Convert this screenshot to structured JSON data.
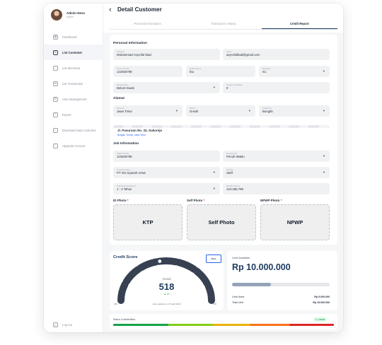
{
  "sidebar": {
    "profile": {
      "name": "Admin Nexs",
      "role": "Admin"
    },
    "items": [
      {
        "label": "Dashboard",
        "icon": "dashboard-icon",
        "glyph": "▦",
        "active": false
      },
      {
        "label": "List Customer",
        "icon": "users-icon",
        "glyph": "☺",
        "active": true
      },
      {
        "label": "List Merchant",
        "icon": "store-icon",
        "glyph": "⌂",
        "active": false
      },
      {
        "label": "List Transaction",
        "icon": "transaction-icon",
        "glyph": "⇄",
        "active": false
      },
      {
        "label": "User Management",
        "icon": "user-gear-icon",
        "glyph": "⚙",
        "active": false
      },
      {
        "label": "Report",
        "icon": "report-icon",
        "glyph": "≡",
        "active": false
      },
      {
        "label": "Download Data Customer",
        "icon": "download-icon",
        "glyph": "↓",
        "active": false
      },
      {
        "label": "Upgrade Account",
        "icon": "upgrade-icon",
        "glyph": "↑",
        "active": false
      }
    ],
    "logout_label": "Log out"
  },
  "header": {
    "title": "Detail Customer",
    "tabs": [
      {
        "label": "Personal Information",
        "active": false
      },
      {
        "label": "Transaction History",
        "active": false
      },
      {
        "label": "Credit Report",
        "active": true
      }
    ]
  },
  "personal": {
    "section_title": "Personal Information",
    "fullname": {
      "label": "Fullname",
      "value": "Muhammad Asyroful Ibad"
    },
    "email": {
      "label": "Email",
      "value": "asyrofulibad@gmail.com"
    },
    "phone": {
      "label": "Phone Number",
      "value": "123456789"
    },
    "mother_name": {
      "label": "Mother Name",
      "value": "Ibu"
    },
    "education": {
      "label": "Education",
      "value": "S1"
    },
    "marital_status": {
      "label": "Marital Status",
      "value": "Belum Kawin"
    },
    "dependents": {
      "label": "Number of Siblings",
      "value": "0"
    }
  },
  "address": {
    "section_title": "Alamat",
    "province": {
      "label": "Province",
      "value": "Jawa Timur"
    },
    "district": {
      "label": "District",
      "value": "Gresik"
    },
    "subdistrict": {
      "label": "Subdistrict",
      "value": "Bungah"
    },
    "street": "Jl. Pasuruan No. 33, Sukorejo",
    "street_detail": "Bungah, Gresik, Jawa Timur"
  },
  "job": {
    "section_title": "Job Information",
    "employee_number": {
      "label": "Wallet Number",
      "value": "123456789"
    },
    "employment_type": {
      "label": "Employment",
      "value": "Penuh Waktu"
    },
    "company": {
      "label": "Company Name",
      "value": "PT Visi Syariah Umat"
    },
    "position": {
      "label": "Position",
      "value": "Staff"
    },
    "work_length": {
      "label": "Total Work Experience",
      "value": "1 - 2 Tahun"
    },
    "monthly_income": {
      "label": "Monthly Income",
      "value": "123.456.789"
    }
  },
  "photos": {
    "id_label": "ID Photo",
    "self_label": "Self Photo",
    "npwp_label": "NPWP Photo",
    "required_mark": "*",
    "id_text": "KTP",
    "self_text": "Self Photo",
    "npwp_text": "NPWP"
  },
  "credit_score": {
    "title": "Credit Score",
    "logo_text": "Nexs",
    "grade": "Good",
    "score": "518",
    "score_value": 518,
    "score_min_value": 300,
    "score_max_value": 780,
    "change": "▲ 12",
    "updated": "Last updated on 27 april 2023",
    "min_label": "300",
    "max_label": "780",
    "colors": {
      "track": "#374151",
      "marker": "#ffffff"
    }
  },
  "limit": {
    "title": "Limit Available",
    "amount": "Rp 10.000.000",
    "used_fraction": 0.4,
    "used_label": "Limit Used",
    "used_value": "Rp 5.000.000",
    "total_label": "Total Limit",
    "total_value": "Rp 15.000.000"
  },
  "status": {
    "title": "Status Kolektibilitas",
    "badge": "1. Lancar"
  },
  "colors": {
    "accent": "#1e3a5f",
    "link": "#2563eb",
    "required": "#dc2626"
  }
}
